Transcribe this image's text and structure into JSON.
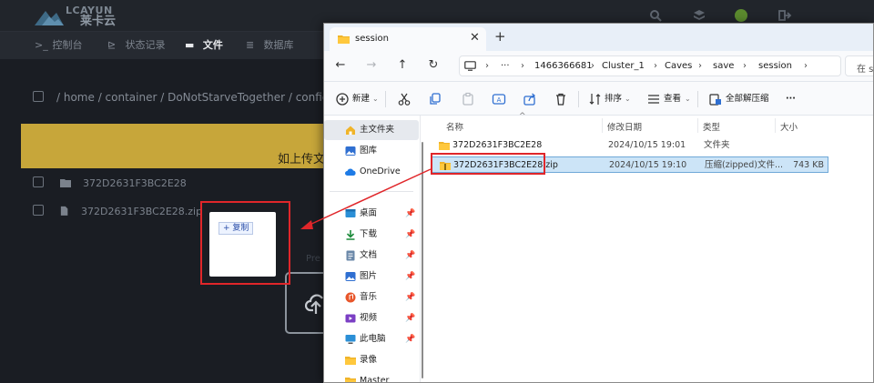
{
  "panel": {
    "logo_text": "LCAYUN",
    "logo_sub": "莱卡云",
    "nav": [
      {
        "icon": ">_",
        "label": "控制台"
      },
      {
        "icon": "⊵",
        "label": "状态记录"
      },
      {
        "icon": "▬",
        "label": "文件"
      },
      {
        "icon": "≣",
        "label": "数据库"
      }
    ],
    "breadcrumb": "/ home / container / DoNotStarveTogether / config / server",
    "banner_text": "如上传文",
    "rows": [
      {
        "name": "372D2631F3BC2E28"
      },
      {
        "name": "372D2631F3BC2E28.zip"
      }
    ],
    "faint_text": "Pre"
  },
  "drag_ghost": {
    "copy_label": "+ 复制"
  },
  "explorer": {
    "tab_title": "session",
    "address": {
      "segments": [
        "1466366681",
        "Cluster_1",
        "Caves",
        "save",
        "session"
      ],
      "ellipsis": "···"
    },
    "search_placeholder": "在 se",
    "commands": {
      "new": "新建",
      "sort": "排序",
      "view": "查看",
      "extract_all": "全部解压缩",
      "more": "···"
    },
    "nav_pane": [
      {
        "label": "主文件夹",
        "icon": "home-icon",
        "pinned": false
      },
      {
        "label": "图库",
        "icon": "gallery-icon",
        "pinned": false
      },
      {
        "label": "OneDrive",
        "icon": "cloud-icon",
        "pinned": false
      },
      {
        "label": "桌面",
        "icon": "desktop-icon",
        "pinned": true
      },
      {
        "label": "下载",
        "icon": "download-icon",
        "pinned": true
      },
      {
        "label": "文档",
        "icon": "document-icon",
        "pinned": true
      },
      {
        "label": "图片",
        "icon": "picture-icon",
        "pinned": true
      },
      {
        "label": "音乐",
        "icon": "music-icon",
        "pinned": true
      },
      {
        "label": "视频",
        "icon": "video-icon",
        "pinned": true
      },
      {
        "label": "此电脑",
        "icon": "computer-icon",
        "pinned": true
      },
      {
        "label": "录像",
        "icon": "folder-icon",
        "pinned": false
      },
      {
        "label": "Master",
        "icon": "folder-icon",
        "pinned": false
      }
    ],
    "pin_glyph": "📌",
    "columns": {
      "name": "名称",
      "date": "修改日期",
      "type": "类型",
      "size": "大小"
    },
    "files": [
      {
        "name": "372D2631F3BC2E28",
        "date": "2024/10/15 19:01",
        "type": "文件夹",
        "size": ""
      },
      {
        "name": "372D2631F3BC2E28.zip",
        "date": "2024/10/15 19:10",
        "type": "压缩(zipped)文件...",
        "size": "743 KB"
      }
    ]
  }
}
